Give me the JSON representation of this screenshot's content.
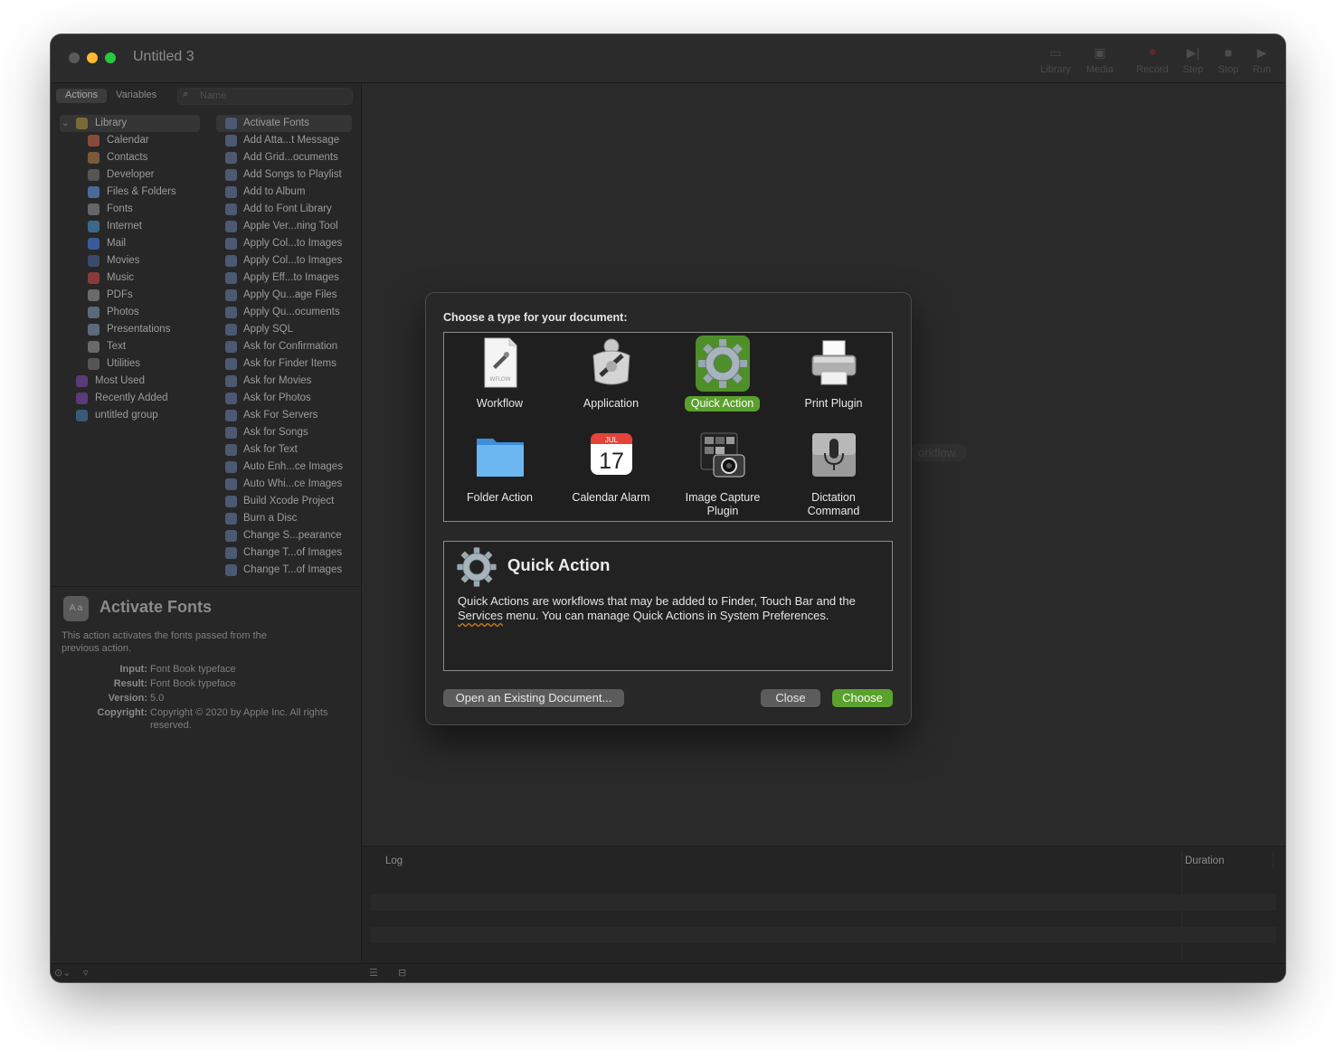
{
  "window": {
    "title": "Untitled 3"
  },
  "toolbar": {
    "library": "Library",
    "media": "Media",
    "record": "Record",
    "step": "Step",
    "stop": "Stop",
    "run": "Run"
  },
  "sidebar": {
    "tabs": [
      "Actions",
      "Variables"
    ],
    "search_placeholder": "Name",
    "library_items": [
      {
        "label": "Library",
        "color": "#7a6a3a"
      },
      {
        "label": "Calendar",
        "color": "#8a4a3a"
      },
      {
        "label": "Contacts",
        "color": "#7a5a3a"
      },
      {
        "label": "Developer",
        "color": "#555555"
      },
      {
        "label": "Files & Folders",
        "color": "#4a6a9a"
      },
      {
        "label": "Fonts",
        "color": "#666666"
      },
      {
        "label": "Internet",
        "color": "#3a6a8a"
      },
      {
        "label": "Mail",
        "color": "#3a5a9a"
      },
      {
        "label": "Movies",
        "color": "#3a4a6a"
      },
      {
        "label": "Music",
        "color": "#8a3a3a"
      },
      {
        "label": "PDFs",
        "color": "#6a6a6a"
      },
      {
        "label": "Photos",
        "color": "#5a6a7a"
      },
      {
        "label": "Presentations",
        "color": "#5a6a7a"
      },
      {
        "label": "Text",
        "color": "#6a6a6a"
      },
      {
        "label": "Utilities",
        "color": "#555555"
      },
      {
        "label": "Most Used",
        "color": "#5a3a7a"
      },
      {
        "label": "Recently Added",
        "color": "#5a3a7a"
      },
      {
        "label": "untitled group",
        "color": "#3a5a7a"
      }
    ],
    "actions": [
      "Activate Fonts",
      "Add Atta...t Message",
      "Add Grid...ocuments",
      "Add Songs to Playlist",
      "Add to Album",
      "Add to Font Library",
      "Apple Ver...ning Tool",
      "Apply Col...to Images",
      "Apply Col...to Images",
      "Apply Eff...to Images",
      "Apply Qu...age Files",
      "Apply Qu...ocuments",
      "Apply SQL",
      "Ask for Confirmation",
      "Ask for Finder Items",
      "Ask for Movies",
      "Ask for Photos",
      "Ask For Servers",
      "Ask for Songs",
      "Ask for Text",
      "Auto Enh...ce Images",
      "Auto Whi...ce Images",
      "Build Xcode Project",
      "Burn a Disc",
      "Change S...pearance",
      "Change T...of Images",
      "Change T...of Images"
    ]
  },
  "description": {
    "title": "Activate Fonts",
    "text": "This action activates the fonts passed from the previous action.",
    "input_label": "Input:",
    "input_value": "Font Book typeface",
    "result_label": "Result:",
    "result_value": "Font Book typeface",
    "version_label": "Version:",
    "version_value": "5.0",
    "copyright_label": "Copyright:",
    "copyright_value": "Copyright © 2020 by Apple Inc. All rights reserved."
  },
  "canvas": {
    "hint": "orkflow."
  },
  "log": {
    "log_header": "Log",
    "duration_header": "Duration"
  },
  "dialog": {
    "prompt": "Choose a type for your document:",
    "types": [
      {
        "label": "Workflow",
        "icon": "workflow-icon"
      },
      {
        "label": "Application",
        "icon": "application-icon"
      },
      {
        "label": "Quick Action",
        "icon": "gear-icon"
      },
      {
        "label": "Print Plugin",
        "icon": "printer-icon"
      },
      {
        "label": "Folder Action",
        "icon": "folder-icon"
      },
      {
        "label": "Calendar Alarm",
        "icon": "calendar-icon"
      },
      {
        "label": "Image Capture Plugin",
        "icon": "camera-icon"
      },
      {
        "label": "Dictation Command",
        "icon": "microphone-icon"
      }
    ],
    "selected_type": "Quick Action",
    "info_title": "Quick Action",
    "info_text_before": "Quick Actions are workflows that may be added to Finder, Touch Bar and the ",
    "info_text_link": "Services",
    "info_text_after": " menu. You can manage Quick Actions in System Preferences.",
    "calendar_month": "JUL",
    "calendar_day": "17",
    "workflow_file_tag": "WFLOW",
    "open_existing": "Open an Existing Document...",
    "close": "Close",
    "choose": "Choose"
  },
  "colors": {
    "accent_green": "#5aa22c",
    "background": "#262626"
  }
}
